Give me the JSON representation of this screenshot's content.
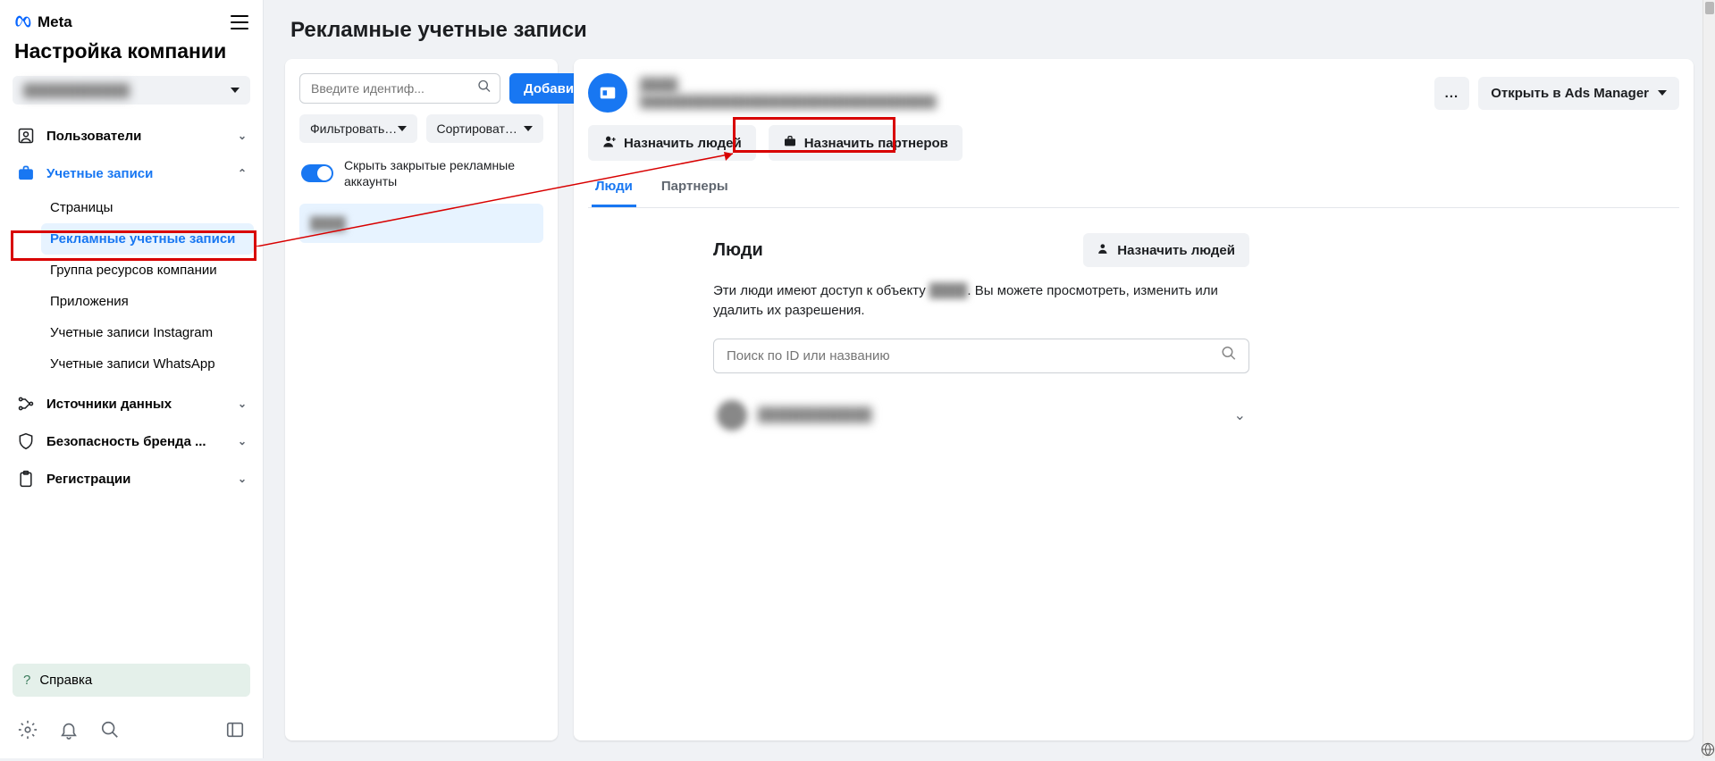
{
  "brand": "Meta",
  "sidebar": {
    "title": "Настройка компании",
    "account_name": "████████████",
    "nav": {
      "users": "Пользователи",
      "accounts": "Учетные записи",
      "data_sources": "Источники данных",
      "brand_safety": "Безопасность бренда ...",
      "registrations": "Регистрации"
    },
    "accounts_sub": {
      "pages": "Страницы",
      "ad_accounts": "Рекламные учетные записи",
      "resource_group": "Группа ресурсов компании",
      "apps": "Приложения",
      "instagram": "Учетные записи Instagram",
      "whatsapp": "Учетные записи WhatsApp"
    },
    "help": "Справка"
  },
  "main": {
    "title": "Рекламные учетные записи",
    "search_placeholder": "Введите идентиф...",
    "add_button": "Добавить",
    "filter": "Фильтровать ...",
    "sort": "Сортировать ...",
    "toggle_label": "Скрыть закрытые рекламные аккаунты",
    "list_item": "████"
  },
  "detail": {
    "title_blur": "████",
    "subtitle_blur": "████████████████████████████████████",
    "more": "...",
    "open_ads_manager": "Открыть в Ads Manager",
    "assign_people": "Назначить людей",
    "assign_partners": "Назначить партнеров"
  },
  "tabs": {
    "people": "Люди",
    "partners": "Партнеры"
  },
  "people_section": {
    "heading": "Люди",
    "assign_button": "Назначить людей",
    "description_pre": "Эти люди имеют доступ к объекту ",
    "description_blur": "████",
    "description_post": ". Вы можете просмотреть, изменить или удалить их разрешения.",
    "search_placeholder": "Поиск по ID или названию",
    "person_name": "████████████"
  }
}
